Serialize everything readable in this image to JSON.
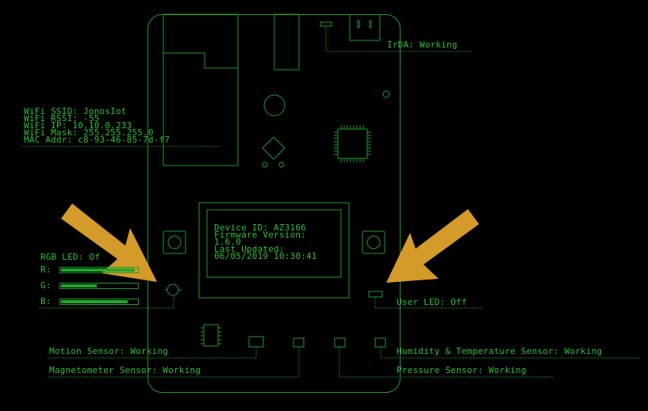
{
  "wifi": {
    "ssid": "WiFi SSID: JonosIot",
    "rssi": "WiFi RSSI: -55",
    "ip": "WiFi IP: 10.10.0.233",
    "mask": "WiFi Mask: 255.255.255.0",
    "mac": "MAC Addr: c8-93-46-85-7d-f7"
  },
  "irda": "IrDA: Working",
  "oled": {
    "line1": "Device ID: AZ3166",
    "line2": "Firmware Version:",
    "line3": "1.6.0",
    "line4": "Last Updated:",
    "line5": "06/05/2019 10:30:41"
  },
  "rgb": {
    "title": "RGB LED: Of",
    "r_label": "R:",
    "g_label": "G:",
    "b_label": "B:",
    "r_level": 0.97,
    "g_level": 0.47,
    "b_level": 0.88
  },
  "user_led": "User LED: Off",
  "sensors": {
    "motion": "Motion Sensor: Working",
    "magnetometer": "Magnetometer Sensor: Working",
    "humidity": "Humidity & Temperature Sensor: Working",
    "pressure": "Pressure Sensor: Working"
  },
  "colors": {
    "green": "#2fbf3a",
    "arrow": "#d49a2a",
    "background": "#000000"
  }
}
